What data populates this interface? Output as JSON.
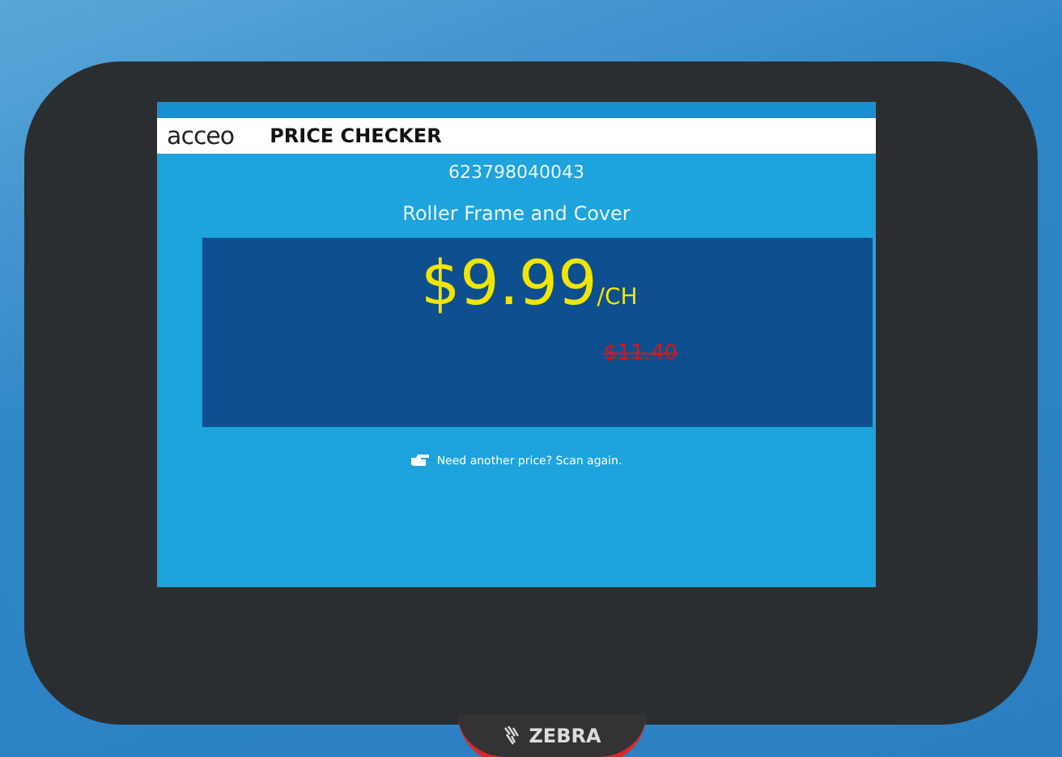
{
  "header": {
    "logo": "acceo",
    "title": "PRICE CHECKER"
  },
  "product": {
    "barcode": "623798040043",
    "name": "Roller Frame and Cover"
  },
  "price": {
    "current": "$9.99",
    "unit": "/CH",
    "previous": "$11.40"
  },
  "hint": "Need another price? Scan again.",
  "device": {
    "brand": "ZEBRA"
  }
}
